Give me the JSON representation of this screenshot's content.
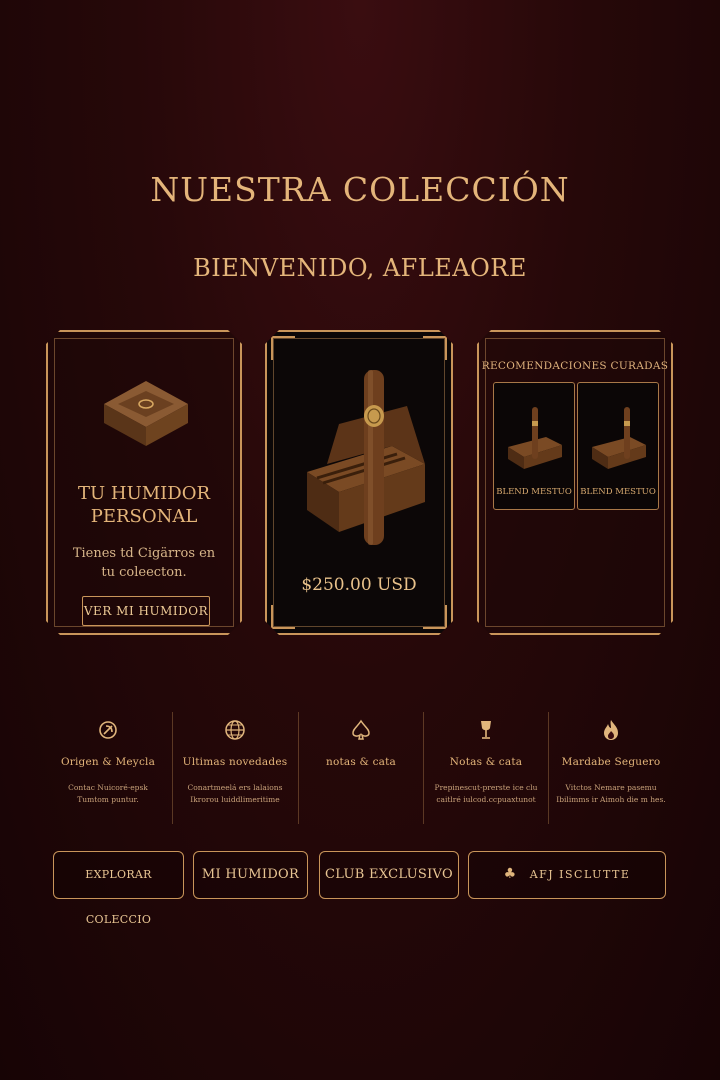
{
  "header": {
    "title": "NUESTRA COLECCIÓN",
    "welcome": "BIENVENIDO, AFLEAORE"
  },
  "humidor_card": {
    "title_line1": "TU HUMIDOR",
    "title_line2": "PERSONAL",
    "text": "Tienes td Cigärros en tu coleecton.",
    "button_label": "VER MI HUMIDOR"
  },
  "product_card": {
    "price": "$250.00 USD"
  },
  "recommendations": {
    "title": "RECOMENDACIONES CURADAS",
    "items": [
      {
        "label": "BLEND MESTUO"
      },
      {
        "label": "BLEND MESTUO"
      }
    ]
  },
  "features": [
    {
      "icon": "leaf-icon",
      "title": "Origen & Meycla",
      "desc": "Contac Nuicoré·epsk\nTumtom puntur."
    },
    {
      "icon": "globe-icon",
      "title": "Ultimas novedades",
      "desc": "Conartmeelá ers lalaions\nIkrorou luiddlimeritime"
    },
    {
      "icon": "spade-icon",
      "title": "notas & cata",
      "desc": ""
    },
    {
      "icon": "wine-glass-icon",
      "title": "Notas & cata",
      "desc": "Prepinescut-prerste ice clu\ncaitlré iulcod.ccpuaxtunot"
    },
    {
      "icon": "flame-icon",
      "title": "Mardabe Seguero",
      "desc": "Vitctos Nemare pasemu\nIbilimms ir Aimoh die m hes."
    }
  ],
  "nav": {
    "explorar": "EXPLORAR COLECCIO",
    "humidor": "MI HUMIDOR",
    "club": "CLUB EXCLUSIVO",
    "afj": "AFJ  ISCLUTTE"
  },
  "colors": {
    "accent": "#c9955a",
    "text_gold": "#e4b57a",
    "background": "#260809"
  }
}
